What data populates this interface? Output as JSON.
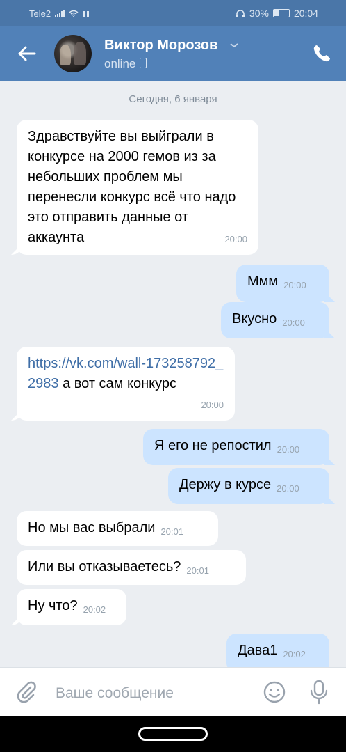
{
  "status_bar": {
    "carrier": "Tele2",
    "battery": "30%",
    "time": "20:04"
  },
  "header": {
    "contact_name": "Виктор Морозов",
    "presence": "online"
  },
  "chat": {
    "date_separator": "Сегодня, 6 января",
    "messages": [
      {
        "direction": "in",
        "text": "Здравствуйте вы выйграли в конкурсе на 2000 гемов из за небольших проблем мы перенесли конкурс всё что надо это отправить данные от аккаунта",
        "time": "20:00"
      },
      {
        "direction": "out",
        "text": "Ммм",
        "time": "20:00"
      },
      {
        "direction": "out",
        "text": "Вкусно",
        "time": "20:00"
      },
      {
        "direction": "in",
        "link": "https://vk.com/wall-173258792_2983",
        "text": "а вот сам конкурс",
        "time": "20:00"
      },
      {
        "direction": "out",
        "text": "Я его не репостил",
        "time": "20:00"
      },
      {
        "direction": "out",
        "text": "Держу в курсе",
        "time": "20:00"
      },
      {
        "direction": "in",
        "text": "Но мы вас выбрали",
        "time": "20:01"
      },
      {
        "direction": "in",
        "text": "Или вы отказываетесь?",
        "time": "20:01"
      },
      {
        "direction": "in",
        "text": "Ну что?",
        "time": "20:02"
      },
      {
        "direction": "out",
        "text": "Дава1",
        "time": "20:02"
      }
    ]
  },
  "composer": {
    "placeholder": "Ваше сообщение"
  },
  "icons": {
    "back": "arrow-left-icon",
    "call": "phone-icon",
    "attach": "paperclip-icon",
    "emoji": "smile-icon",
    "voice": "microphone-icon"
  },
  "colors": {
    "header": "#5181b8",
    "status_bar": "#4a76a8",
    "chat_bg": "#ebeef2",
    "incoming_bubble": "#ffffff",
    "outgoing_bubble": "#cce4ff",
    "link": "#3f6ea7"
  }
}
